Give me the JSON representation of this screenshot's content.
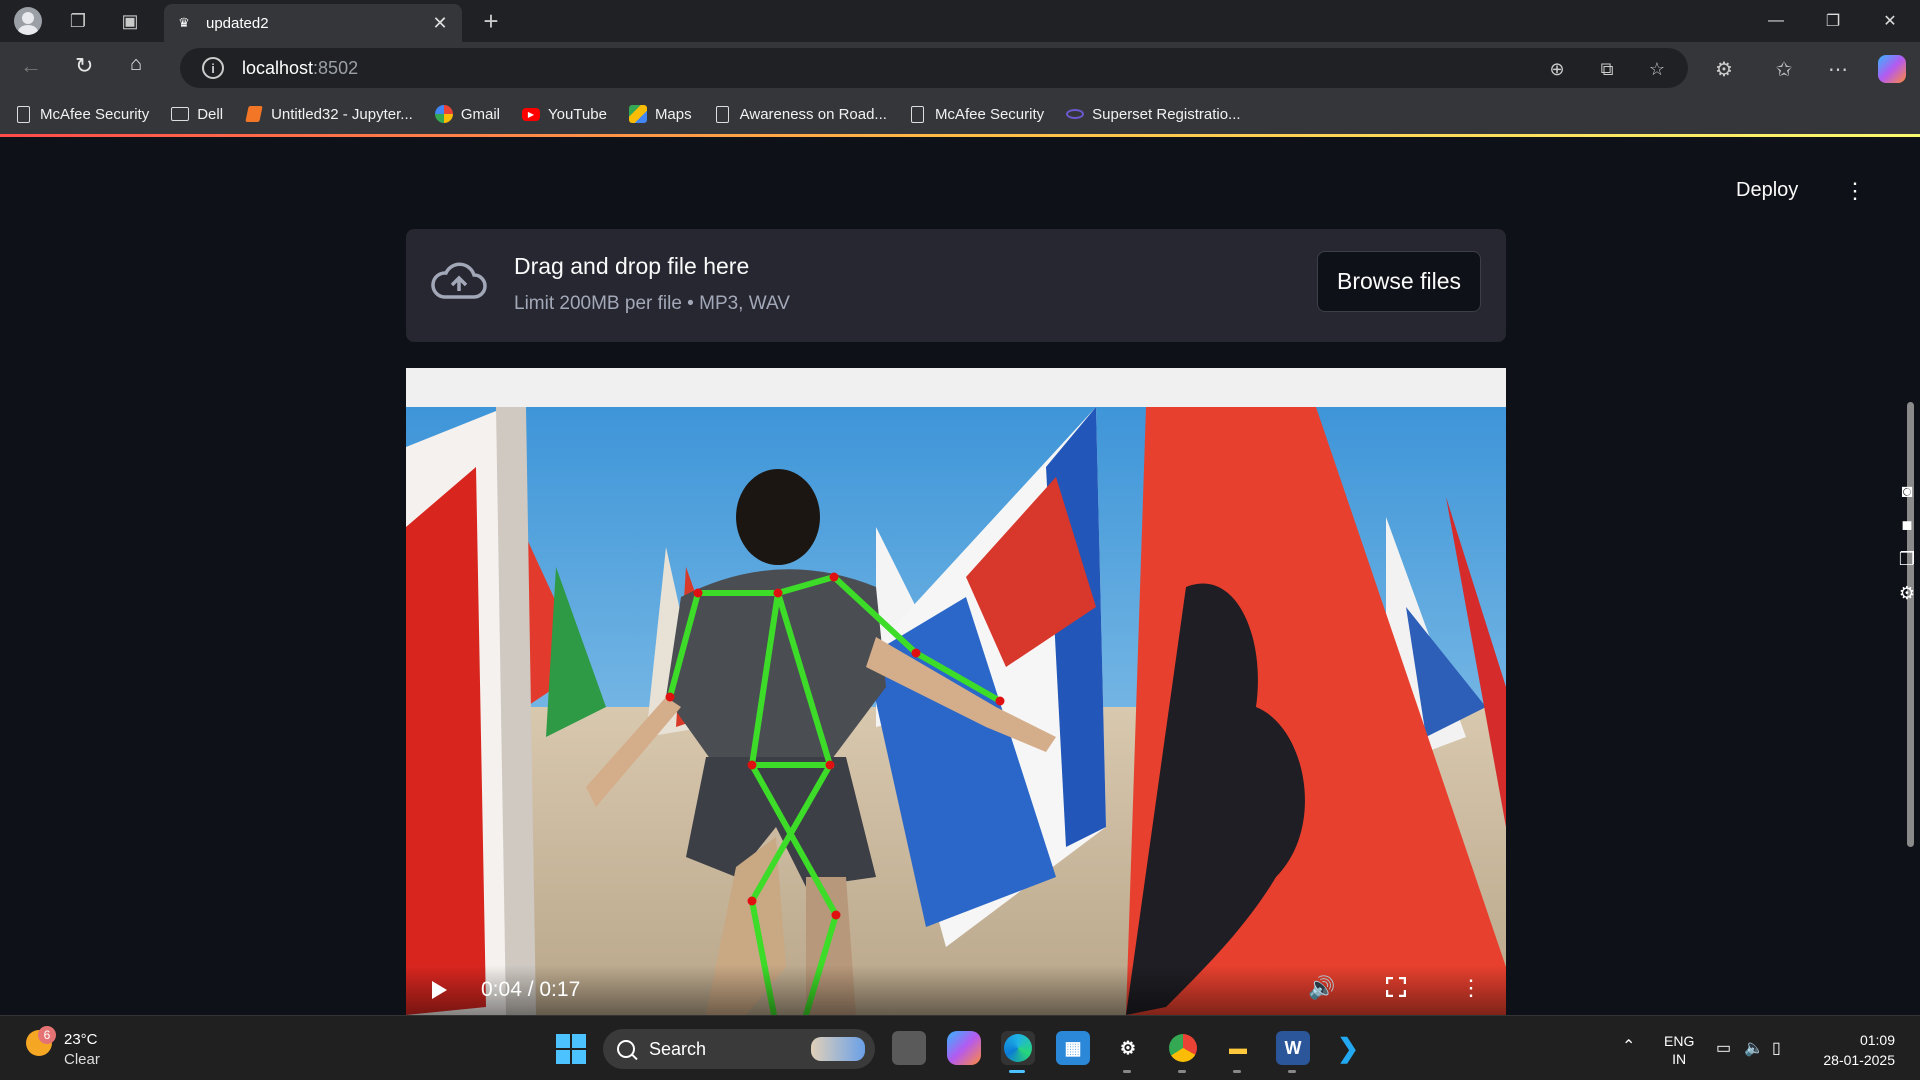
{
  "browser": {
    "tab_title": "updated2",
    "url_host": "localhost",
    "url_port": ":8502",
    "bookmarks": [
      {
        "label": "McAfee Security",
        "icon": "page-icon"
      },
      {
        "label": "Dell",
        "icon": "folder-icon"
      },
      {
        "label": "Untitled32 - Jupyter...",
        "icon": "jupyter-icon"
      },
      {
        "label": "Gmail",
        "icon": "google-icon"
      },
      {
        "label": "YouTube",
        "icon": "youtube-icon"
      },
      {
        "label": "Maps",
        "icon": "maps-icon"
      },
      {
        "label": "Awareness on Road...",
        "icon": "page-icon"
      },
      {
        "label": "McAfee Security",
        "icon": "page-icon"
      },
      {
        "label": "Superset Registratio...",
        "icon": "superset-icon"
      }
    ]
  },
  "app": {
    "deploy_label": "Deploy",
    "uploader": {
      "title": "Drag and drop file here",
      "limit": "Limit 200MB per file • MP3, WAV",
      "browse_label": "Browse files"
    },
    "video": {
      "time": "0:04 / 0:17",
      "progress": 0.235
    }
  },
  "taskbar": {
    "weather_badge": "6",
    "weather_temp": "23°C",
    "weather_cond": "Clear",
    "search_label": "Search",
    "lang_line1": "ENG",
    "lang_line2": "IN",
    "time": "01:09",
    "date": "28-01-2025"
  },
  "colors": {
    "app_bg": "#0e1117",
    "uploader_bg": "#262730",
    "skeleton_line": "#3cdc28",
    "keypoint": "#e01010"
  }
}
